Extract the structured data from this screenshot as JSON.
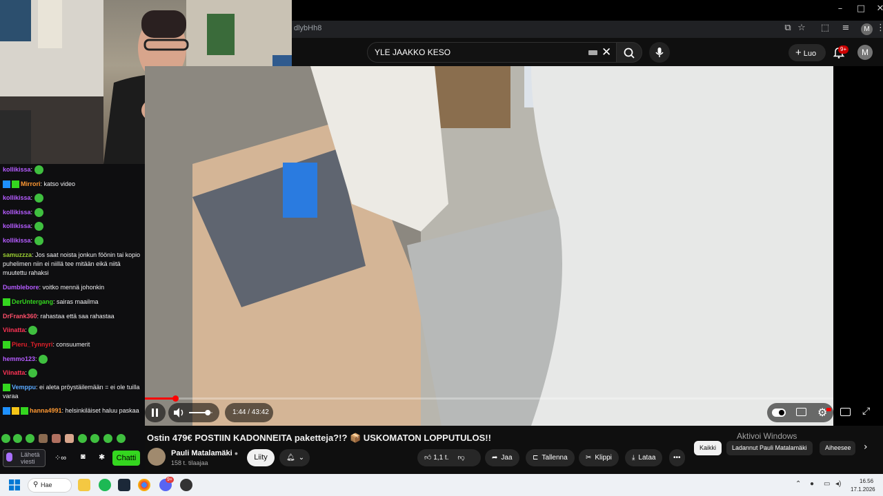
{
  "browser": {
    "url_fragment": "dlybHh8",
    "window_buttons": [
      "–",
      "□",
      "✕"
    ],
    "profile_initial": "M"
  },
  "youtube_header": {
    "search_value": "YLE JAAKKO KESO",
    "create_label": "Luo",
    "notification_count": "9+",
    "avatar_initial": "M"
  },
  "chat": {
    "messages": [
      {
        "user": "kollikissa",
        "color": "#b55cff",
        "text": "",
        "badges": []
      },
      {
        "user": "Mirrori",
        "color": "#ff9933",
        "text": "katso video",
        "badges": [
          "#1e90ff",
          "#34d61f"
        ]
      },
      {
        "user": "kollikissa",
        "color": "#b55cff",
        "text": "",
        "badges": []
      },
      {
        "user": "kollikissa",
        "color": "#b55cff",
        "text": "",
        "badges": []
      },
      {
        "user": "kollikissa",
        "color": "#b55cff",
        "text": "",
        "badges": []
      },
      {
        "user": "kollikissa",
        "color": "#b55cff",
        "text": "",
        "badges": []
      },
      {
        "user": "samuzzza",
        "color": "#9acd32",
        "text": "Jos saat noista jonkun föönin tai kopio puhelimen niin ei niillä tee mitään eikä niitä muutettu rahaksi",
        "badges": []
      },
      {
        "user": "Dumblebore",
        "color": "#b55cff",
        "text": "voitko mennä johonkin",
        "badges": []
      },
      {
        "user": "DerUntergang",
        "color": "#34d61f",
        "text": "sairas maailma",
        "badges": [
          "#34d61f"
        ]
      },
      {
        "user": "DrFrank360",
        "color": "#ff4f6a",
        "text": "rahastaa että saa rahastaa",
        "badges": []
      },
      {
        "user": "Viinatta",
        "color": "#ff3355",
        "text": "",
        "badges": []
      },
      {
        "user": "Pieru_Tynnyri",
        "color": "#e0202a",
        "text": "consuumerit",
        "badges": [
          "#34d61f"
        ]
      },
      {
        "user": "hemmo123",
        "color": "#b55cff",
        "text": "",
        "badges": []
      },
      {
        "user": "Viinatta",
        "color": "#ff3355",
        "text": "",
        "badges": []
      },
      {
        "user": "Vemppu",
        "color": "#5aa9ff",
        "text": "ei aleta pröystäilemään = ei ole tuilla varaa",
        "badges": [
          "#34d61f"
        ]
      },
      {
        "user": "hanna4991",
        "color": "#ff9933",
        "text": "helsinkiläiset haluu paskaa",
        "badges": [
          "#1e90ff",
          "#f5c518",
          "#34d61f"
        ]
      }
    ],
    "input_placeholder": "Lähetä viesti",
    "send_label": "Chatti"
  },
  "player": {
    "progress": 0.044,
    "volume": 0.5,
    "time_display": "1:44 / 43:42"
  },
  "video_info": {
    "title": "Ostin 479€ POSTIIN KADONNEITA paketteja?!? 📦 USKOMATON LOPPUTULOS!!",
    "channel_name": "Pauli Matalamäki",
    "subscribers": "158 t. tilaajaa",
    "join_label": "Liity",
    "like_count": "1,1 t.",
    "share_label": "Jaa",
    "save_label": "Tallenna",
    "clip_label": "Klippi",
    "download_label": "Lataa"
  },
  "chips": {
    "all": "Kaikki",
    "uploaded_by": "Ladannut Pauli Matalamäki",
    "related": "Aiheesee"
  },
  "windows_watermark": "Aktivoi Windows",
  "taskbar": {
    "search_label": "Hae",
    "time": "16.56",
    "date": "17.1.2026",
    "discord_badge": "9+"
  }
}
